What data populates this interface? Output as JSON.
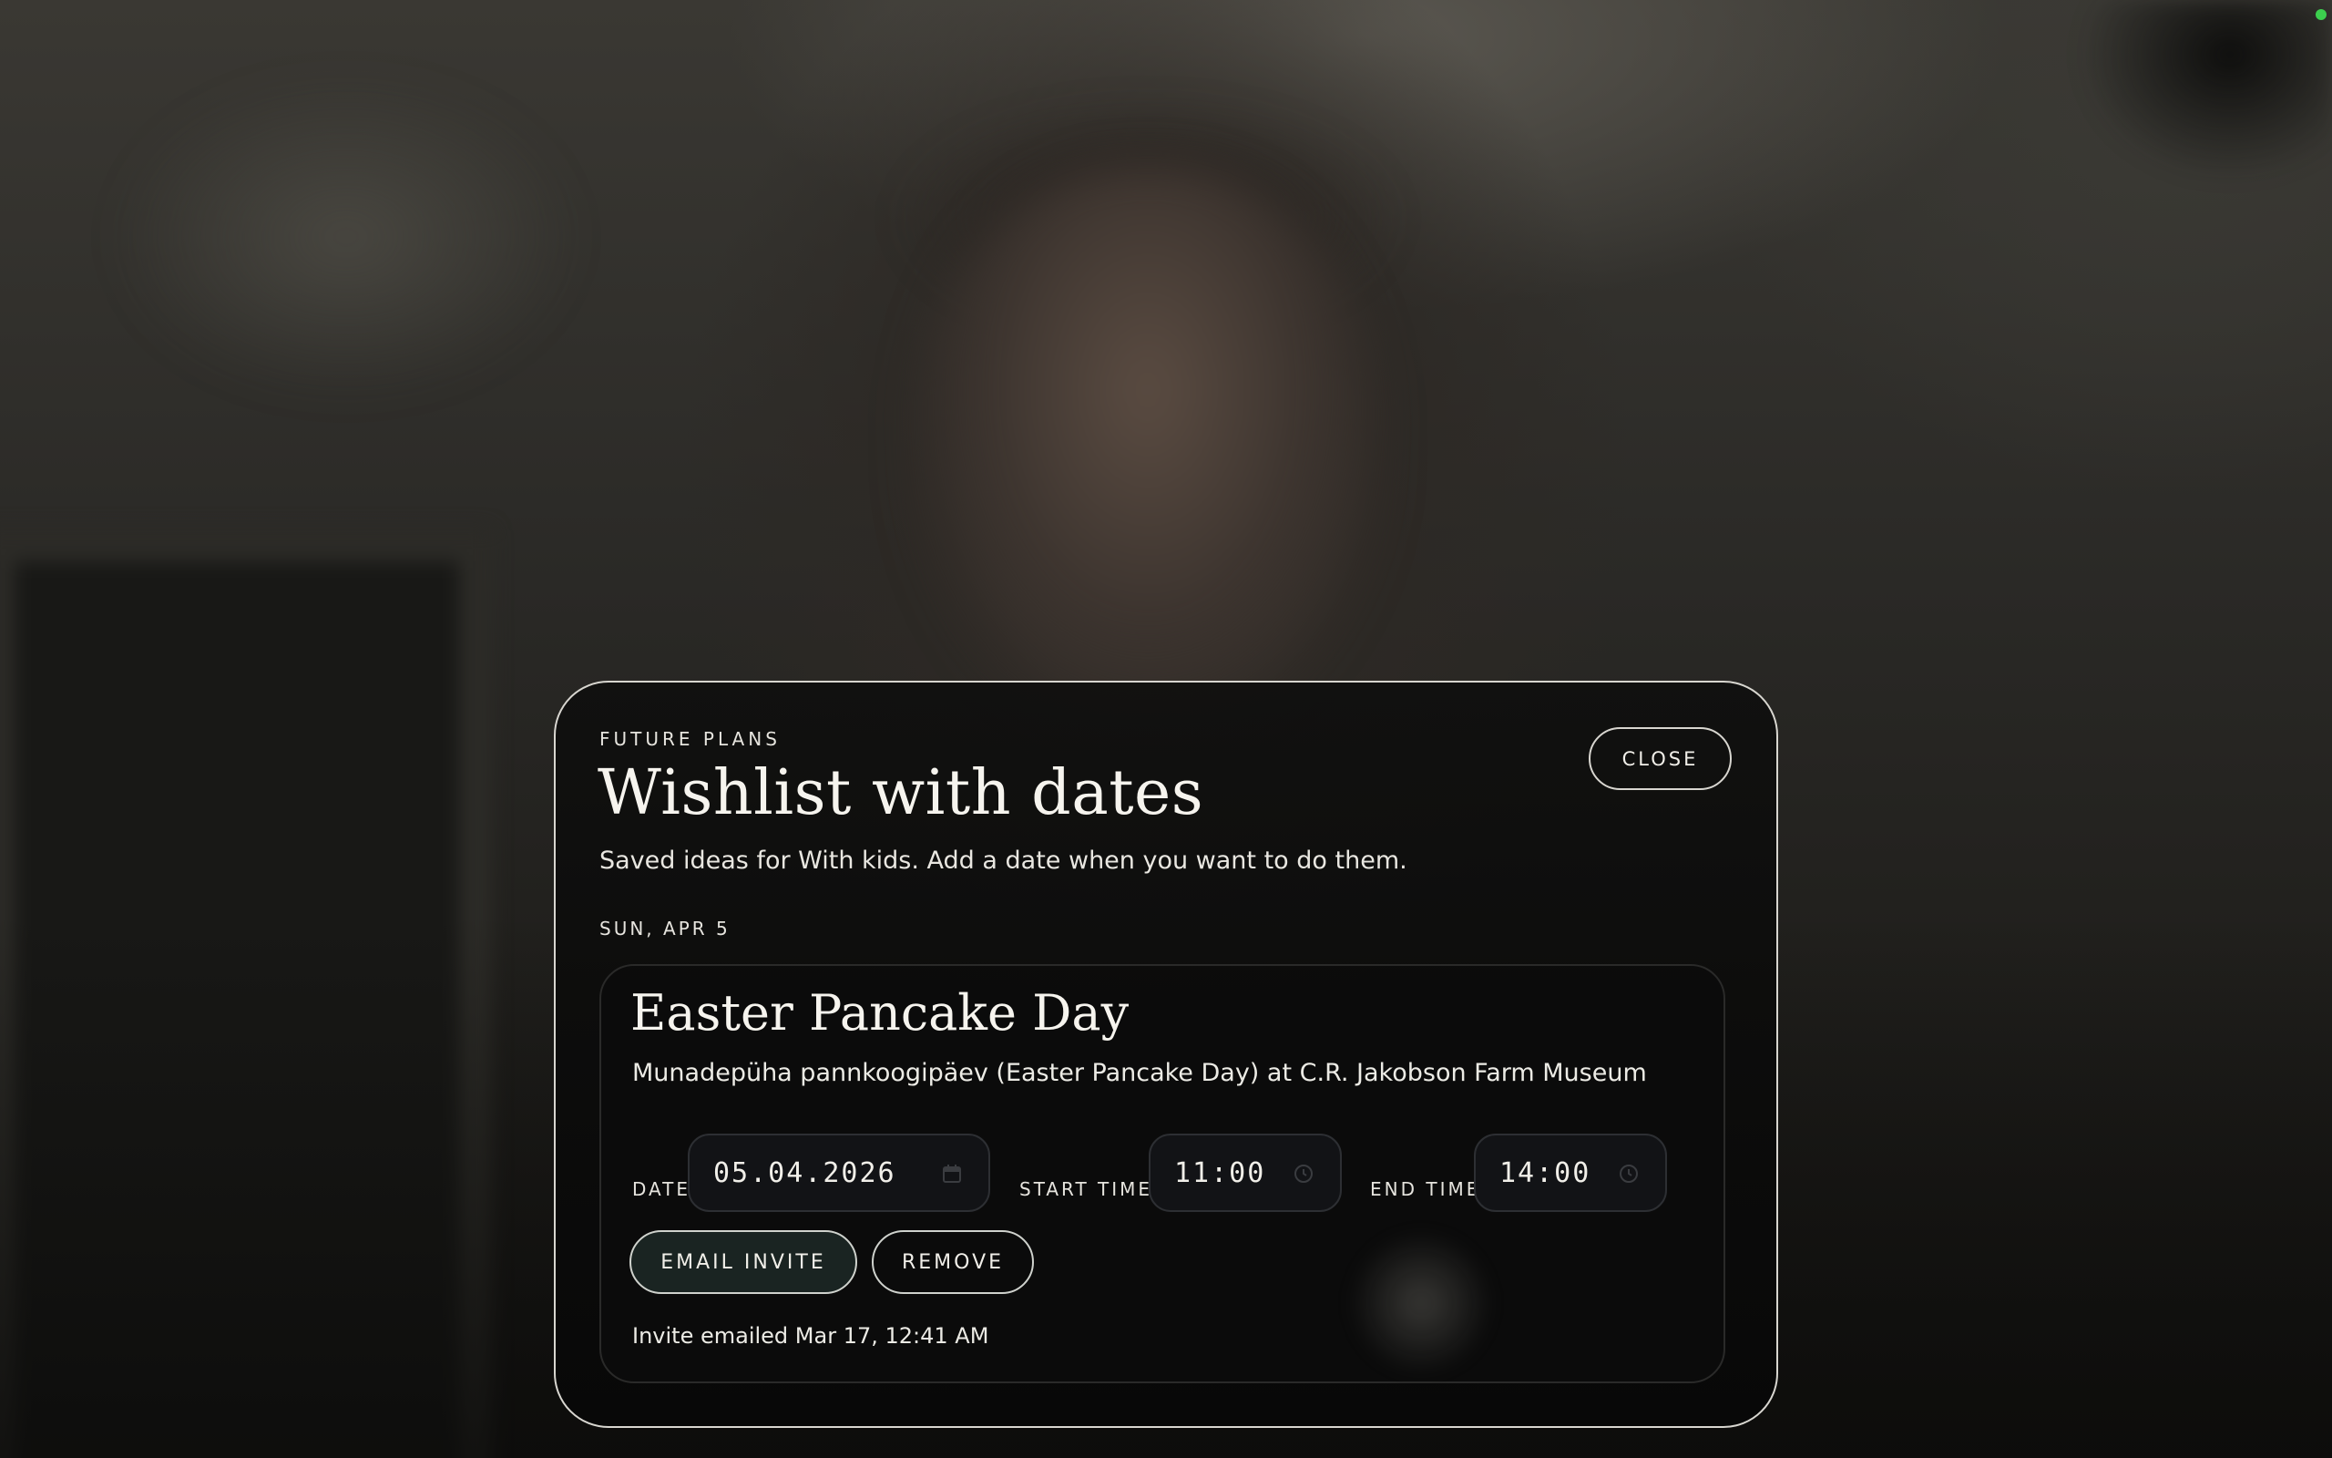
{
  "modal": {
    "eyebrow": "FUTURE PLANS",
    "title": "Wishlist with dates",
    "subtitle": "Saved ideas for With kids. Add a date when you want to do them.",
    "close_label": "CLOSE"
  },
  "day_group": {
    "label": "SUN, APR 5"
  },
  "event": {
    "title": "Easter Pancake Day",
    "description": "Munadepüha pannkoogipäev (Easter Pancake Day) at C.R. Jakobson Farm Museum",
    "date_label": "DATE",
    "date_value": "05.04.2026",
    "date_icon": "calendar-icon",
    "start_label": "START TIME",
    "start_value": "11:00",
    "start_icon": "clock-icon",
    "end_label": "END TIME",
    "end_value": "14:00",
    "end_icon": "clock-icon",
    "email_invite_label": "EMAIL INVITE",
    "remove_label": "REMOVE",
    "invite_status": "Invite emailed Mar 17, 12:41 AM"
  },
  "colors": {
    "accent_button_bg": "#1a2422",
    "status_dot": "#3ccf4e",
    "modal_border": "#d8d6d0"
  }
}
